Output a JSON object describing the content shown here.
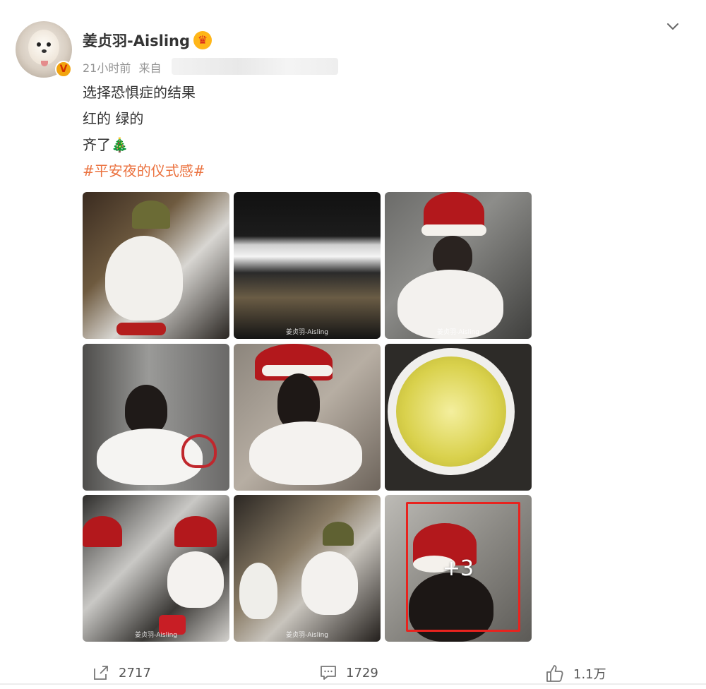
{
  "post": {
    "author": "姜贞羽-Aisling",
    "time": "21小时前",
    "source_prefix": "来自",
    "lines": [
      "选择恐惧症的结果",
      "红的 绿的",
      "齐了🎄"
    ],
    "hashtag": "#平安夜的仪式感#",
    "verified_badge": "V",
    "more_photos": "+3",
    "watermark": "姜贞羽-Aisling"
  },
  "actions": {
    "share_count": "2717",
    "comment_count": "1729",
    "like_count": "1.1万"
  },
  "icons": {
    "expand": "chevron-down-icon",
    "crown": "crown-icon",
    "share": "share-icon",
    "comment": "comment-icon",
    "like": "thumbs-up-icon"
  },
  "colors": {
    "hashtag": "#eb7340",
    "highlight_box": "#e8231e",
    "badge": "#f2a40f"
  }
}
